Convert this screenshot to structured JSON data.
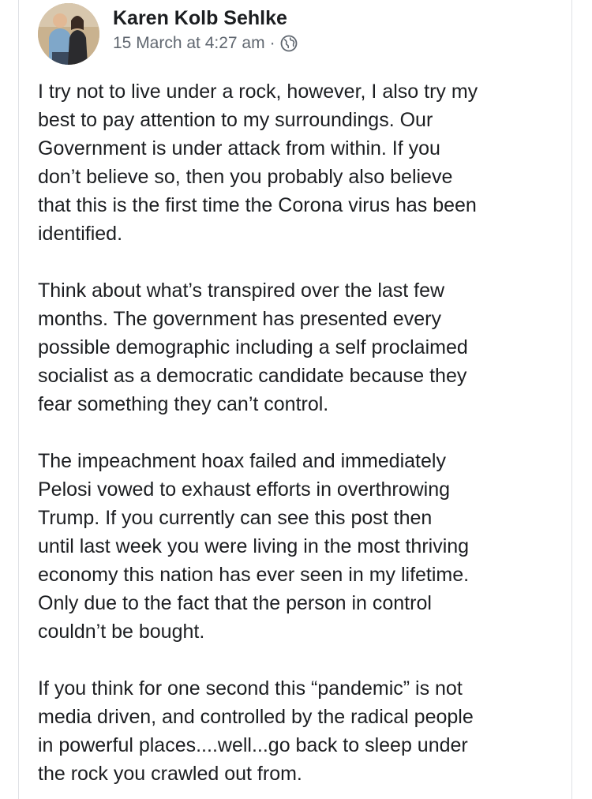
{
  "post": {
    "author": "Karen Kolb Sehlke",
    "timestamp": "15 March at 4:27 am",
    "separator": "·",
    "privacy_icon": "globe-icon",
    "avatar_icon": "avatar-photo",
    "paragraphs": [
      "I try not to live under a rock, however, I also try my\nbest to pay attention to my surroundings.  Our\nGovernment is under attack from within.  If you\ndon’t believe so, then you probably also believe\nthat this is the first time the Corona virus has been\nidentified.",
      "Think about what’s transpired over the last few\nmonths.  The government has presented every\npossible demographic including a self proclaimed\nsocialist as a democratic candidate because they\nfear something they can’t control.",
      "The impeachment hoax failed and immediately\nPelosi vowed to exhaust efforts in overthrowing\nTrump.  If you currently can see this post then\nuntil last week you were living in the most thriving\neconomy this nation has ever seen in my lifetime.\nOnly due to the fact that the person in control\ncouldn’t be bought.",
      "If you think for one second this “pandemic” is not\nmedia driven, and controlled by the radical people\nin powerful places....well...go back to sleep under\nthe rock you crawled out from."
    ]
  },
  "colors": {
    "text": "#1c1e21",
    "secondary_text": "#606770",
    "border": "#dfe1e5",
    "background": "#ffffff"
  }
}
